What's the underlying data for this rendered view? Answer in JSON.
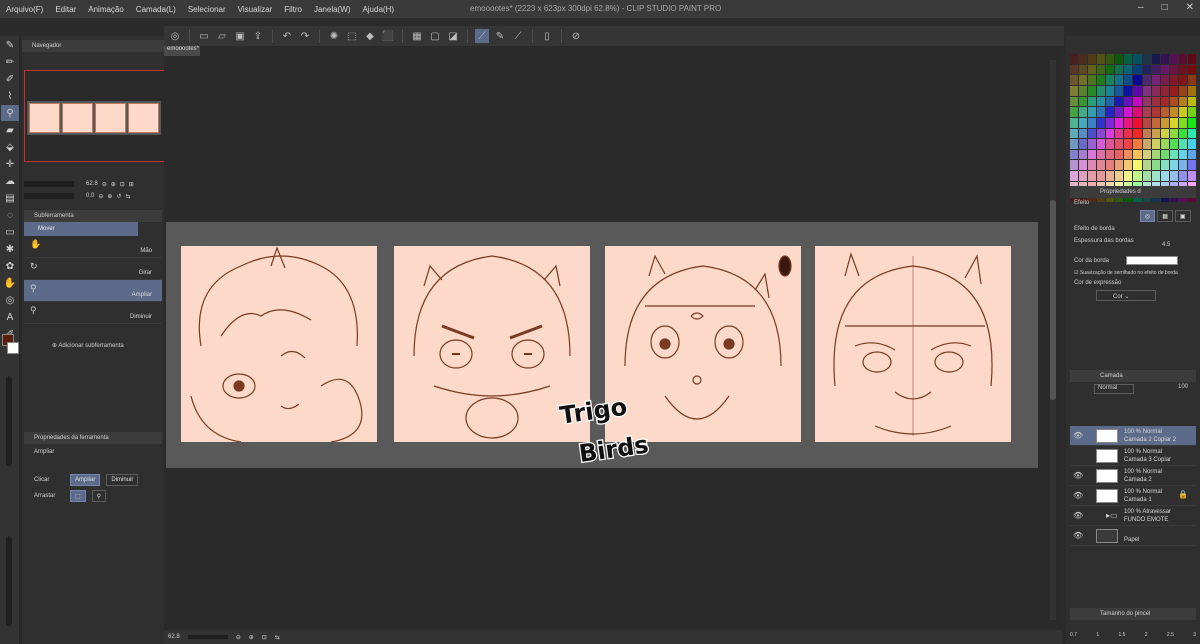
{
  "app": {
    "title": "emooootes* (2223 x 623px 300dpi 62.8%) - CLIP STUDIO PAINT PRO",
    "menu": [
      "Arquivo(F)",
      "Editar",
      "Animação",
      "Camada(L)",
      "Selecionar",
      "Visualizar",
      "Filtro",
      "Janela(W)",
      "Ajuda(H)"
    ],
    "window_buttons": [
      "–",
      "□",
      "✕"
    ]
  },
  "navigator": {
    "title": "Navegador",
    "zoom": "62.8",
    "rotation": "0.0"
  },
  "subtool": {
    "panel_title": "Subferramenta",
    "group": "Mover",
    "items": [
      {
        "label": "Mão",
        "icon": "hand-icon"
      },
      {
        "label": "Girar",
        "icon": "rotate-icon"
      },
      {
        "label": "Ampliar",
        "icon": "zoom-in-icon"
      },
      {
        "label": "Diminuir",
        "icon": "zoom-out-icon"
      }
    ],
    "add_label": "Adicionar subferramenta"
  },
  "tool_properties": {
    "panel_title": "Propriedades da ferramenta",
    "tool_name": "Ampliar",
    "click_label": "Clicar",
    "click_options": [
      "Ampliar",
      "Diminuir"
    ],
    "drag_label": "Arrastar"
  },
  "document": {
    "tab_label": "emooootes*",
    "watermark_line1": "Trigo",
    "watermark_line2": "Birds"
  },
  "statusbar": {
    "zoom": "62.8"
  },
  "layer_props": {
    "title": "Propriedades d",
    "effect_label": "Efeito",
    "border_effect_label": "Efeito de borda",
    "border_thickness_label": "Espessura das bordas",
    "border_thickness_value": "4.5",
    "border_color_label": "Cor da borda",
    "smoothing_label": "Suavização de serrilhado no efeito de borda",
    "expression_color_label": "Cor de expressão",
    "expression_color_value": "Cor"
  },
  "layers": {
    "title": "Camada",
    "blend_mode": "Normal",
    "opacity": "100",
    "items": [
      {
        "line1": "100 % Normal",
        "line2": "Camada 2 Copiar 2",
        "selected": true
      },
      {
        "line1": "100 % Normal",
        "line2": "Camada 3 Copiar",
        "selected": false
      },
      {
        "line1": "100 % Normal",
        "line2": "Camada 2",
        "selected": false
      },
      {
        "line1": "100 % Normal",
        "line2": "Camada 1",
        "selected": false,
        "locked": true
      },
      {
        "line1": "100 % Atravessar",
        "line2": "FUNDO EMOTE",
        "selected": false,
        "folder": true
      },
      {
        "line1": "",
        "line2": "Papel",
        "selected": false
      }
    ]
  },
  "brush_size": {
    "title": "Tamanho do pincel",
    "values": [
      "0.7",
      "1",
      "1.5",
      "2",
      "2.5",
      "3"
    ]
  },
  "colors": {
    "accent": "#5d6b8a",
    "main_color": "#5a1e10",
    "sub_color": "#ffffff",
    "canvas_bg": "#fcd9c8",
    "line_color": "#7a3a22"
  }
}
